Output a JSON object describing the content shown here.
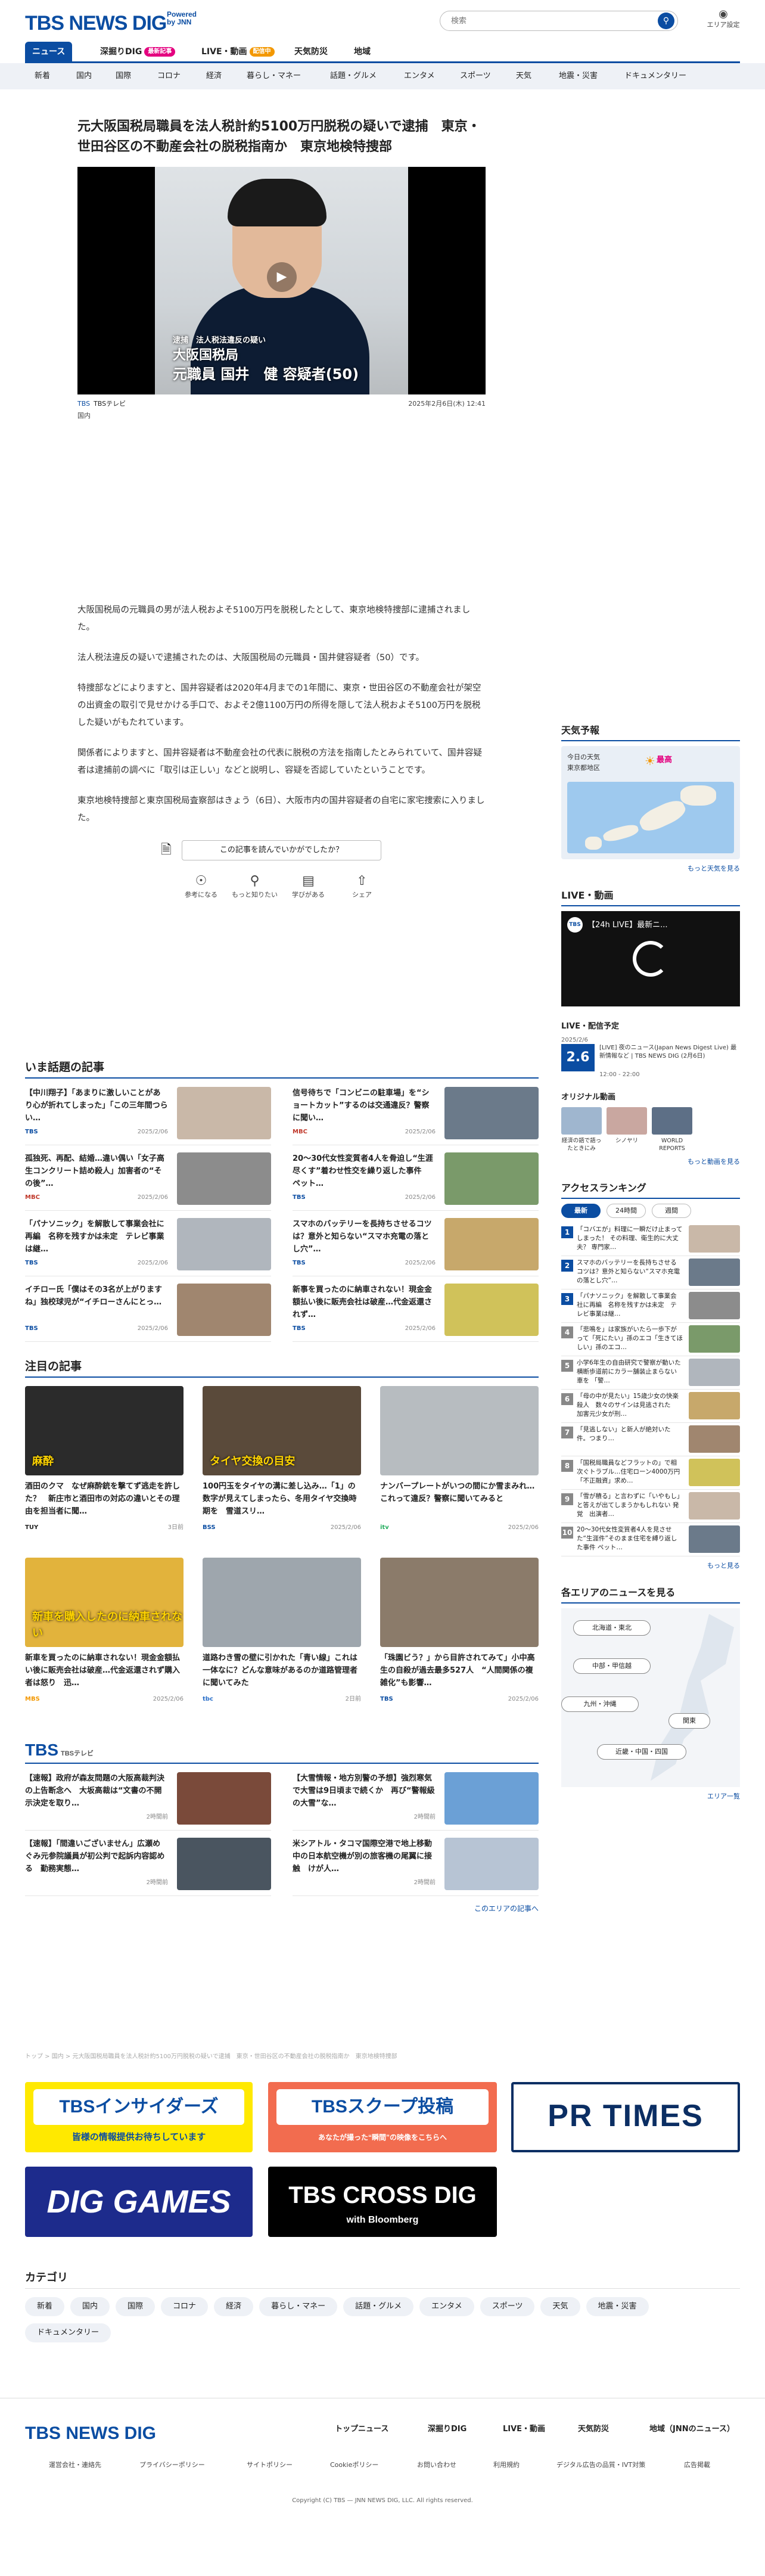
{
  "header": {
    "logo": "TBS NEWS DIG",
    "logo_sub": "Powered by JNN",
    "search_placeholder": "検索",
    "area_label": "エリア設定"
  },
  "tabs": [
    {
      "label": "ニュース"
    },
    {
      "label": "深掘りDIG",
      "badge": "最新記事"
    },
    {
      "label": "LIVE・動画",
      "badge": "配信中"
    },
    {
      "label": "天気防災"
    },
    {
      "label": "地域"
    }
  ],
  "categories": [
    "新着",
    "国内",
    "国際",
    "コロナ",
    "経済",
    "暮らし・マネー",
    "話題・グルメ",
    "エンタメ",
    "スポーツ",
    "天気",
    "地震・災害",
    "ドキュメンタリー"
  ],
  "article": {
    "title": "元大阪国税局職員を法人税計約5100万円脱税の疑いで逮捕　東京・世田谷区の不動産会社の脱税指南か　東京地検特捜部",
    "video_caption": {
      "l1": "逮捕　法人税法違反の疑い",
      "l2": "大阪国税局",
      "l3": "元職員 国井　健 容疑者(50)"
    },
    "source": "TBS",
    "source_sub": "TBSテレビ",
    "genre": "国内",
    "date": "2025年2月6日(木) 12:41",
    "paragraphs": [
      "大阪国税局の元職員の男が法人税およそ5100万円を脱税したとして、東京地検特捜部に逮捕されました。",
      "法人税法違反の疑いで逮捕されたのは、大阪国税局の元職員・国井健容疑者（50）です。",
      "特捜部などによりますと、国井容疑者は2020年4月までの1年間に、東京・世田谷区の不動産会社が架空の出資金の取引で見せかける手口で、およそ2億1100万円の所得を隠して法人税およそ5100万円を脱税した疑いがもたれています。",
      "関係者によりますと、国井容疑者は不動産会社の代表に脱税の方法を指南したとみられていて、国井容疑者は逮捕前の調べに「取引は正しい」などと説明し、容疑を否認していたということです。",
      "東京地検特捜部と東京国税局査察部はきょう（6日）、大阪市内の国井容疑者の自宅に家宅捜索に入りました。"
    ],
    "poll": "この記事を読んでいかがでしたか？",
    "reactions": [
      "参考になる",
      "もっと知りたい",
      "学びがある",
      "シェア"
    ]
  },
  "sidebar": {
    "weather_title": "天気予報",
    "weather_today": "今日の天気",
    "weather_region": "東京都地区",
    "weather_hi": "最高",
    "more_weather": "もっと天気を見る",
    "live_title": "LIVE・動画",
    "live_video": "【24h LIVE】最新ニ...",
    "live_sched_title": "LIVE・配信予定",
    "sched_date": "2025/2/6",
    "sched_ch": "2.6",
    "sched_text": "[LIVE] 夜のニュース(Japan News Digest Live) 最新情報など | TBS NEWS DIG (2月6日)",
    "sched_time": "12:00 - 22:00",
    "orig_title": "オリジナル動画",
    "orig": [
      "経済の語で語ったときにみ",
      "シノヤリ",
      "WORLD REPORTS"
    ],
    "more_videos": "もっと動画を見る",
    "rank_title": "アクセスランキング",
    "rank_tabs": [
      "最新",
      "24時間",
      "週間"
    ],
    "ranking": [
      "「コバエが」料理に一瞬だけ止まってしまった！ その料理、衛生的に大丈夫？ 専門家…",
      "スマホのバッテリーを長持ちさせるコツは？意外と知らない“スマホ充電の落とし穴”…",
      "「パナソニック」を解散して事業会社に再編　名称を残すかは未定　テレビ事業は継…",
      "「悲鳴を」は家族がいたら一歩下がって「死にたい」孫のエコ「生きてほしい」孫のエコ…",
      "小学6年生の自由研究で警察が動いた 横断歩道前にカラー舗装止まらない車を 「警…",
      "「母の中が見たい」15歳少女の快楽殺人　数々のサインは見逃された　加害元少女が刑…",
      "「見逃しない」と新人が絶対いた件。つまり…",
      "「国税局職員などフラットの」で相次ぐトラブル…住宅ローン4000万円「不正融資」求め…",
      "「雪が積る」と言わずに「いやもし」と答えが出てしまうかもしれない 発覚　出演者…",
      "20〜30代女性変質者4人を見させた“生涯件”そのまま住宅を縛り返した事件 ペット…"
    ],
    "more_rank": "もっと見る",
    "area_title": "各エリアのニュースを見る",
    "area_buttons": [
      "北海道・東北",
      "中部・甲信越",
      "九州・沖縄",
      "関東",
      "近畿・中国・四国"
    ],
    "area_more": "エリア一覧"
  },
  "topics": {
    "title": "いま話題の記事",
    "items": [
      {
        "t": "【中川翔子】「あまりに激しいことがあり心が折れてしまった」「この三年間つらい…",
        "s": "TBS",
        "d": "2025/2/06"
      },
      {
        "t": "信号待ちで「コンビニの駐車場」を“ショートカット”するのは交通違反？警察に聞い…",
        "s": "MBC",
        "d": "2025/2/06"
      },
      {
        "t": "孤独死、再配、結婚…違い偶い「女子高生コンクリート詰め殺人」加害者の“その後”…",
        "s": "MBC",
        "d": "2025/2/06"
      },
      {
        "t": "20〜30代女性変質者4人を骨迫し“生涯尽くす”着わせ性交を繰り返した事件　ペット…",
        "s": "TBS",
        "d": "2025/2/06"
      },
      {
        "t": "「パナソニック」を解散して事業会社に再編　名称を残すかは未定　テレビ事業は継…",
        "s": "TBS",
        "d": "2025/2/06"
      },
      {
        "t": "スマホのバッテリーを長持ちさせるコツは？意外と知らない“スマホ充電の落とし穴”…",
        "s": "TBS",
        "d": "2025/2/06"
      },
      {
        "t": "イチロー氏「僕はその3名が上がりますね」独校球児が“イチローさんにとっ…",
        "s": "TBS",
        "d": "2025/2/06"
      },
      {
        "t": "新事を買ったのに納車されない！現金金額払い後に販売会社は破産…代金返還されず…",
        "s": "TBS",
        "d": "2025/2/06"
      }
    ]
  },
  "features": {
    "title": "注目の記事",
    "items": [
      {
        "t": "酒田のクマ　なぜ麻酔銃を撃てず逃走を許した？　新庄市と酒田市の対応の違いとその理由を担当者に聞…",
        "s": "TUY",
        "d": "3日前",
        "tag": "麻酔"
      },
      {
        "t": "100円玉をタイヤの溝に差し込み…「1」の数字が見えてしまったら、冬用タイヤ交換時期を　雪道スリ…",
        "s": "BSS",
        "d": "2025/2/06",
        "tag": "タイヤ交換の目安"
      },
      {
        "t": "ナンバープレートがいつの間にか雪まみれ…これって違反？警察に聞いてみると",
        "s": "itv",
        "d": "2025/2/06",
        "tag": ""
      },
      {
        "t": "新車を買ったのに納車されない！現金金額払い後に販売会社は破産…代金返還されず購入者は怒り　迅…",
        "s": "MBS",
        "d": "2025/2/06",
        "tag": "新車を購入したのに納車されない"
      },
      {
        "t": "道路わき雪の壁に引かれた「青い線」これは一体なに？どんな意味があるのか道路管理者に聞いてみた",
        "s": "tbc",
        "d": "2日前",
        "tag": ""
      },
      {
        "t": "「珠園ビう？」から目許されてみて」小中高生の自殺が過去最多527人　“人間関係の複雑化”も影響…",
        "s": "TBS",
        "d": "2025/2/06",
        "tag": ""
      }
    ]
  },
  "tbs_block": {
    "logo": "TBS",
    "logo_sub": "TBSテレビ",
    "items": [
      {
        "t": "【速報】政府が森友問題の大阪高裁判決の上告断念へ　大坂高裁は“文書の不開示決定を取り…",
        "d": "2時間前"
      },
      {
        "t": "【大雪情報・地方別警の予想】強烈寒気で大雪は9日頃まで続くか　再び“警報級の大雪”な…",
        "d": "2時間前"
      },
      {
        "t": "【速報】「間違いございません」広瀬めぐみ元参院議員が初公判で起訴内容認める　勤務実態…",
        "d": "2時間前"
      },
      {
        "t": "米シアトル・タコマ国際空港で地上移動中の日本航空機が別の旅客機の尾翼に接触　けが人…",
        "d": "2時間前"
      }
    ],
    "more": "このエリアの記事へ"
  },
  "breadcrumb": "トップ > 国内 > 元大阪国税局職員を法人税計約5100万円脱税の疑いで逮捕　東京・世田谷区の不動産会社の脱税指南か　東京地検特捜部",
  "banners": {
    "insider": "TBSインサイダーズ",
    "insider_sub": "皆様の情報提供お待ちしています",
    "scoop": "TBSスクープ投稿",
    "scoop_sub": "あなたが撮った“瞬間”の映像をこちらへ",
    "prtimes": "PR TIMES",
    "games": "DIG GAMES",
    "crossdig": "TBS CROSS DIG",
    "crossdig_sub": "with Bloomberg"
  },
  "category_section": {
    "title": "カテゴリ",
    "chips": [
      "新着",
      "国内",
      "国際",
      "コロナ",
      "経済",
      "暮らし・マネー",
      "話題・グルメ",
      "エンタメ",
      "スポーツ",
      "天気",
      "地震・災害",
      "ドキュメンタリー"
    ]
  },
  "footer": {
    "logo": "TBS NEWS DIG",
    "nav": [
      "トップニュース",
      "深掘りDIG",
      "LIVE・動画",
      "天気防災",
      "地域（JNNのニュース）"
    ],
    "links": [
      "運営会社・連絡先",
      "プライバシーポリシー",
      "サイトポリシー",
      "Cookieポリシー",
      "お問い合わせ",
      "利用規約",
      "デジタル広告の品質・IVT対策",
      "広告掲載"
    ],
    "copyright": "Copyright (C) TBS — JNN NEWS DIG, LLC. All rights reserved."
  },
  "colors": {
    "brand": "#0b4da2",
    "accent": "#e4007f",
    "live": "#f39800"
  }
}
